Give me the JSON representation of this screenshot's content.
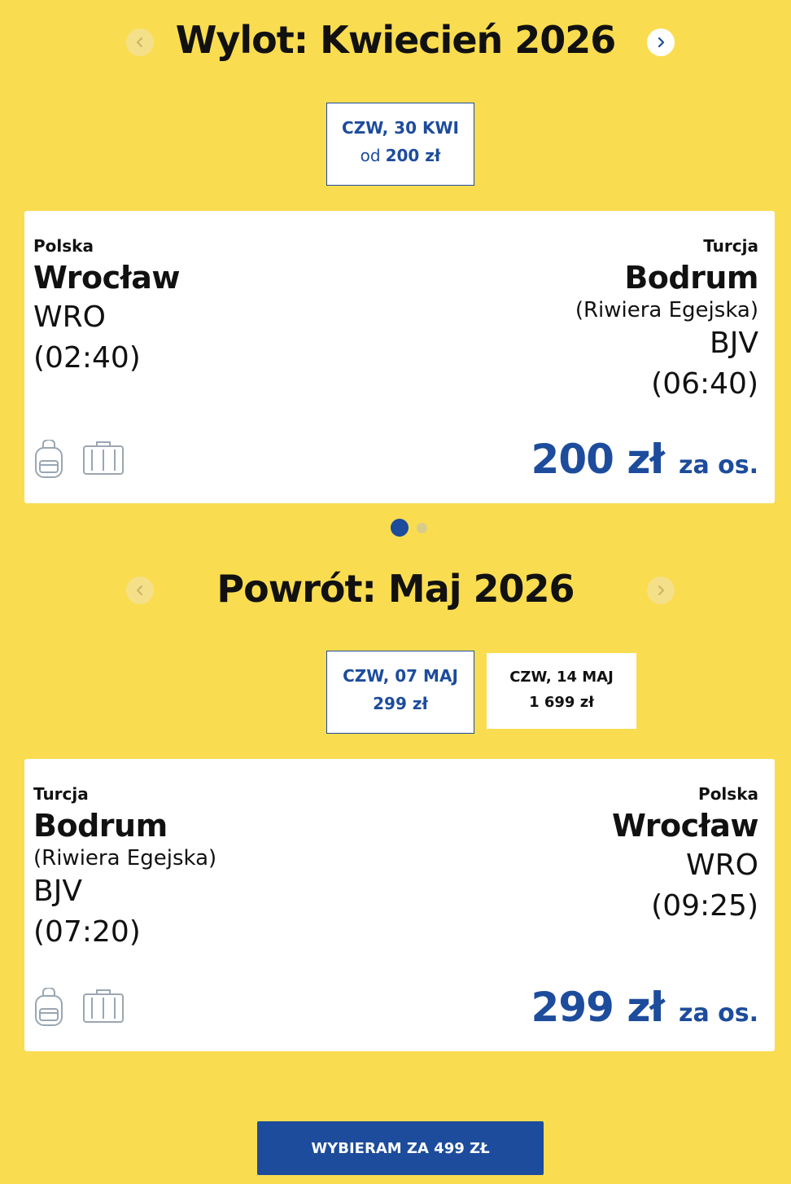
{
  "outbound": {
    "title": "Wylot: Kwiecień 2026",
    "dates": [
      {
        "day": "CZW, 30 KWI",
        "prefix": "od",
        "price": "200 zł",
        "selected": true
      }
    ],
    "flight": {
      "from": {
        "country": "Polska",
        "city": "Wrocław",
        "code": "WRO",
        "time": "(02:40)"
      },
      "to": {
        "country": "Turcja",
        "city": "Bodrum",
        "region": "(Riwiera Egejska)",
        "code": "BJV",
        "time": "(06:40)"
      },
      "price": "200 zł",
      "per_person": "za os."
    }
  },
  "return": {
    "title": "Powrót: Maj 2026",
    "dates": [
      {
        "day": "CZW, 07 MAJ",
        "price": "299 zł",
        "selected": true
      },
      {
        "day": "CZW, 14 MAJ",
        "price": "1 699 zł",
        "selected": false
      }
    ],
    "flight": {
      "from": {
        "country": "Turcja",
        "city": "Bodrum",
        "region": "(Riwiera Egejska)",
        "code": "BJV",
        "time": "(07:20)"
      },
      "to": {
        "country": "Polska",
        "city": "Wrocław",
        "code": "WRO",
        "time": "(09:25)"
      },
      "price": "299 zł",
      "per_person": "za os."
    }
  },
  "carousel": {
    "pages": 2,
    "active": 1
  },
  "cta_label": "WYBIERAM ZA 499 ZŁ",
  "icons": {
    "prev": "chevron-left-icon",
    "next": "chevron-right-icon",
    "bag": "backpack-icon",
    "luggage": "suitcase-icon"
  },
  "colors": {
    "background": "#fadc50",
    "accent": "#1d4c9c",
    "card": "#ffffff"
  }
}
